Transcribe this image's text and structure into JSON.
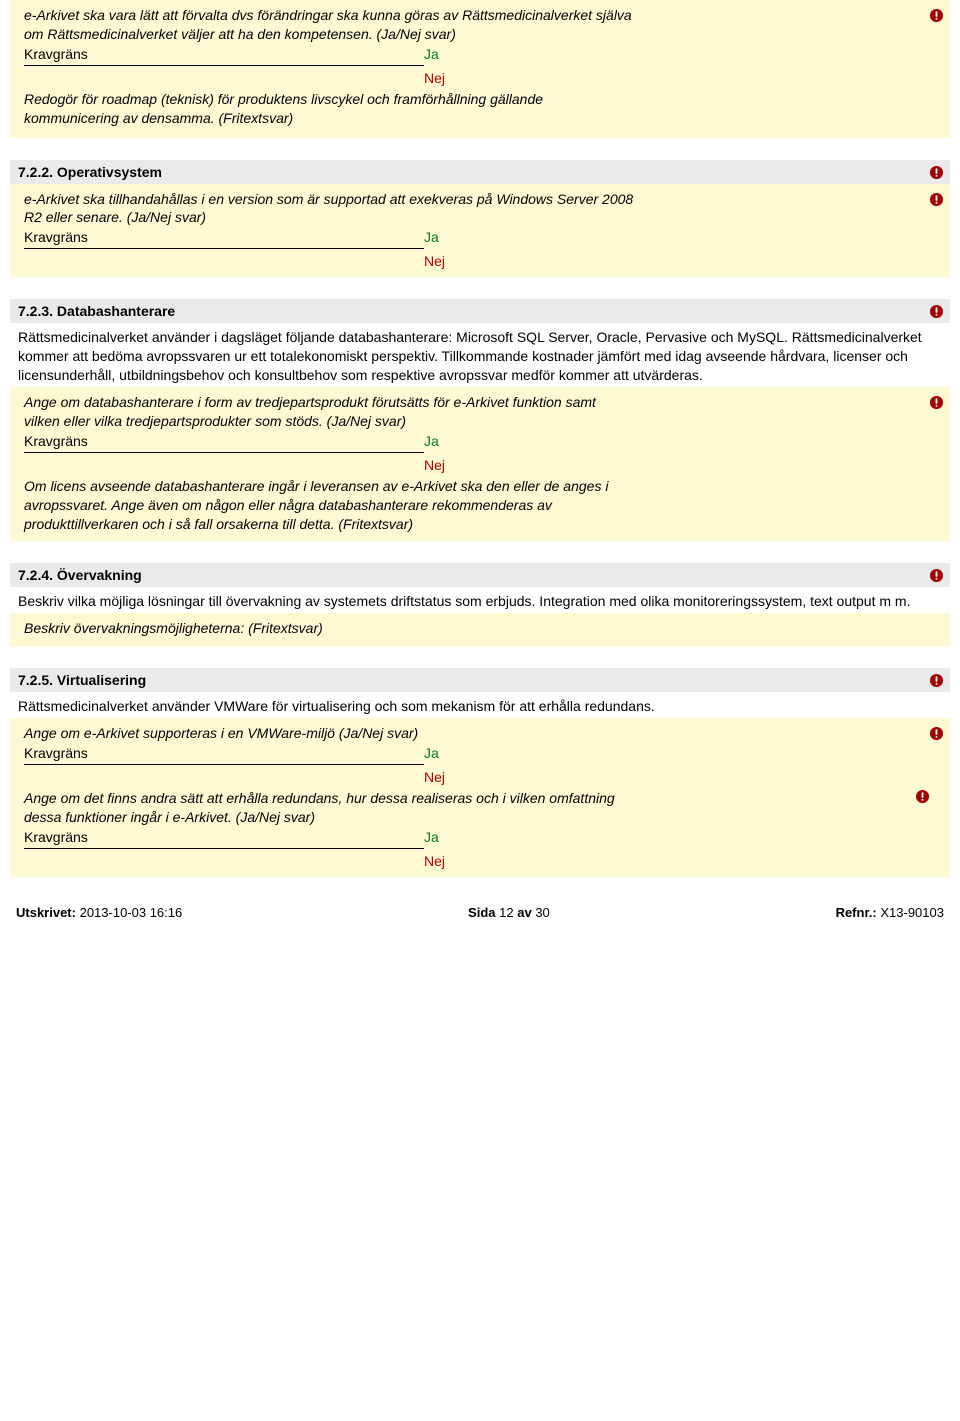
{
  "labels": {
    "kravgrans": "Kravgräns",
    "ja": "Ja",
    "nej": "Nej"
  },
  "top_block": {
    "q1": "e-Arkivet ska vara lätt att förvalta dvs förändringar ska kunna göras av Rättsmedicinalverket själva om Rättsmedicinalverket väljer att ha den kompetensen. (Ja/Nej svar)",
    "q2": "Redogör för roadmap (teknisk) för produktens livscykel och framförhållning gällande kommunicering av densamma. (Fritextsvar)"
  },
  "s722": {
    "title": "7.2.2. Operativsystem",
    "q1": "e-Arkivet ska tillhandahållas i en version som är supportad att exekveras på Windows Server 2008 R2 eller senare. (Ja/Nej svar)"
  },
  "s723": {
    "title": "7.2.3. Databashanterare",
    "intro": "Rättsmedicinalverket använder i dagsläget följande databashanterare: Microsoft SQL Server, Oracle, Pervasive och MySQL. Rättsmedicinalverket kommer att bedöma avropssvaren ur ett totalekonomiskt perspektiv. Tillkommande kostnader jämfört med idag avseende hårdvara, licenser och licensunderhåll, utbildningsbehov och konsultbehov som respektive avropssvar medför kommer att utvärderas.",
    "q1": "Ange om databashanterare i form av tredjepartsprodukt förutsätts för e-Arkivet funktion samt vilken eller vilka tredjepartsprodukter som stöds. (Ja/Nej svar)",
    "q2": "Om licens avseende databashanterare ingår i leveransen av e-Arkivet ska den eller de anges i avropssvaret. Ange även om någon eller några databashanterare rekommenderas av produkttillverkaren och i så fall orsakerna till detta. (Fritextsvar)"
  },
  "s724": {
    "title": "7.2.4. Övervakning",
    "intro": "Beskriv vilka möjliga lösningar till övervakning av systemets driftstatus som erbjuds. Integration med olika monitoreringssystem, text output m m.",
    "q1": "Beskriv övervakningsmöjligheterna: (Fritextsvar)"
  },
  "s725": {
    "title": "7.2.5. Virtualisering",
    "intro": "Rättsmedicinalverket använder VMWare för virtualisering och som mekanism för att erhålla redundans.",
    "q1": "Ange om e-Arkivet supporteras i en VMWare-miljö (Ja/Nej svar)",
    "q2": "Ange om det finns andra sätt att erhålla redundans, hur dessa realiseras och i vilken omfattning dessa funktioner ingår i e-Arkivet. (Ja/Nej svar)"
  },
  "footer": {
    "printed_label": "Utskrivet:",
    "printed_value": "2013-10-03 16:16",
    "page_label": "Sida",
    "page_current": "12",
    "page_of": "av",
    "page_total": "30",
    "ref_label": "Refnr.:",
    "ref_value": "X13-90103"
  }
}
